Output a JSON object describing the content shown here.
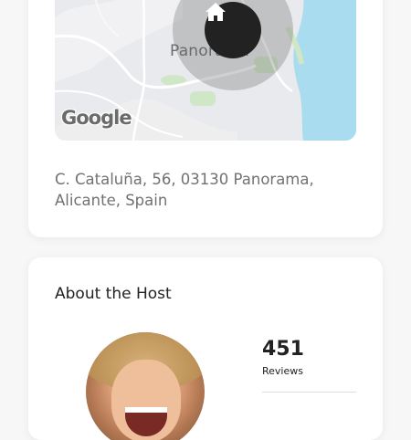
{
  "location": {
    "map_label": "Panorama",
    "map_attribution": "Google",
    "address": "C. Cataluña, 56, 03130 Panorama, Alicante, Spain"
  },
  "host": {
    "section_title": "About the Host",
    "reviews_count": "451",
    "reviews_label": "Reviews"
  },
  "icons": {
    "pin": "home-icon"
  },
  "colors": {
    "map_water": "#a9dcee",
    "map_land": "#e8e9ec",
    "map_park": "#cfe7c7",
    "pin_background": "#222222",
    "text_primary": "#222222",
    "text_secondary": "#717171"
  }
}
